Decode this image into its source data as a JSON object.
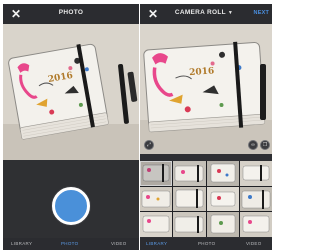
{
  "left_screen": {
    "title": "PHOTO",
    "close_icon": "close-icon",
    "tabs": [
      "LIBRARY",
      "PHOTO",
      "VIDEO"
    ],
    "active_tab": "PHOTO",
    "notebook_year": "2016"
  },
  "right_screen": {
    "title": "CAMERA ROLL",
    "dropdown_icon": "chevron-down-icon",
    "next_label": "NEXT",
    "close_icon": "close-icon",
    "tabs": [
      "LIBRARY",
      "PHOTO",
      "VIDEO"
    ],
    "active_tab": "LIBRARY",
    "notebook_year": "2016",
    "thumbnail_count": 12
  },
  "colors": {
    "accent": "#4a90d9",
    "bar_bg": "#2b2c30",
    "panel_bg": "#2e2f33"
  }
}
